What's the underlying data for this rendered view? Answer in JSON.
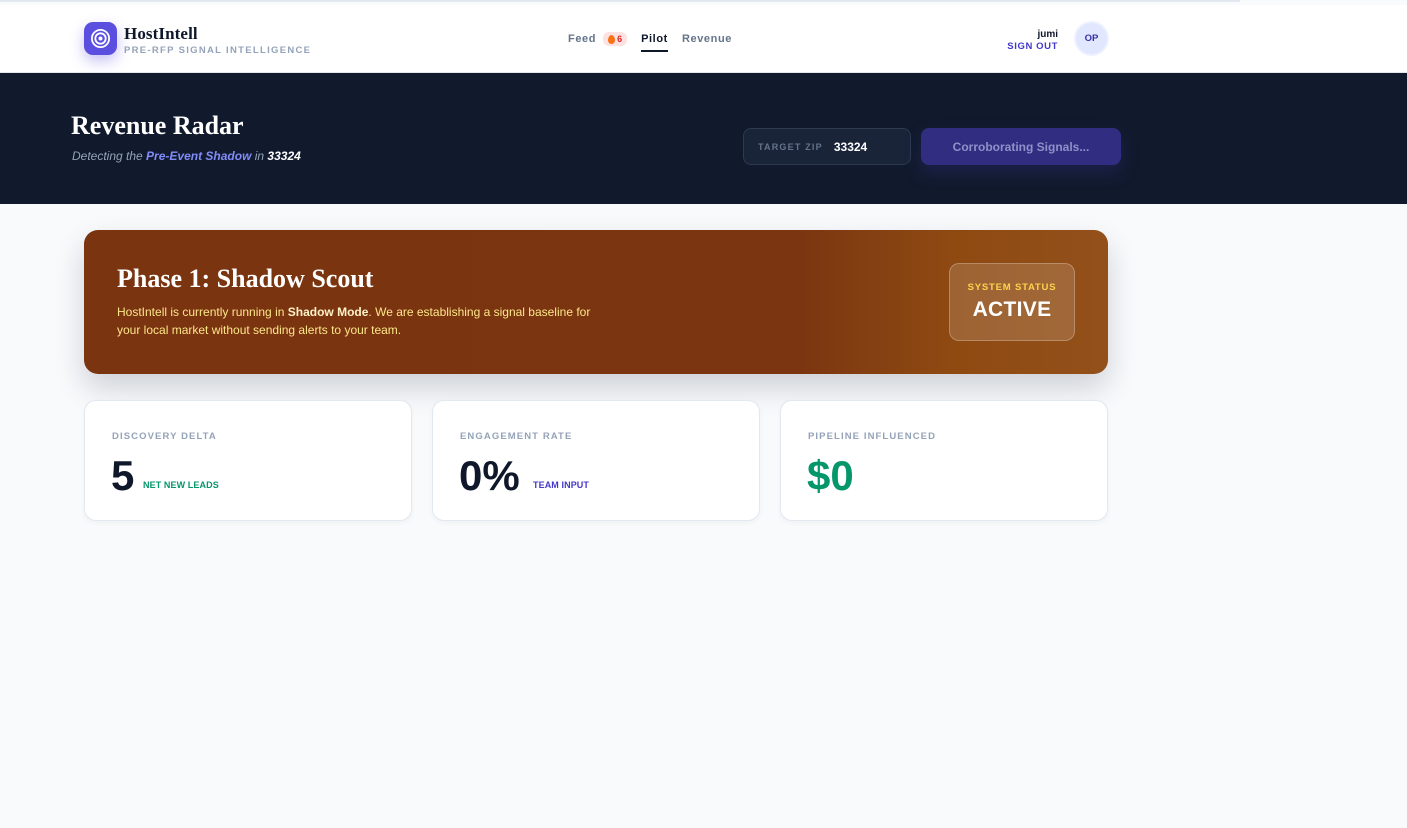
{
  "header": {
    "brand_name": "HostIntell",
    "brand_tagline": "PRE-RFP SIGNAL INTELLIGENCE",
    "nav": [
      {
        "label": "Feed",
        "badge": "6",
        "active": false
      },
      {
        "label": "Pilot",
        "active": true
      },
      {
        "label": "Revenue",
        "active": false
      }
    ],
    "user_name": "jumi",
    "sign_out_label": "SIGN OUT",
    "avatar_initials": "OP"
  },
  "hero": {
    "title": "Revenue Radar",
    "subtitle_prefix": "Detecting the ",
    "subtitle_highlight": "Pre-Event Shadow",
    "subtitle_mid": " in ",
    "subtitle_zip": "33324",
    "zip_label": "TARGET ZIP",
    "zip_value": "33324",
    "action_label": "Corroborating Signals..."
  },
  "phase": {
    "title": "Phase 1: Shadow Scout",
    "text_prefix": "HostIntell is currently running in ",
    "text_bold": "Shadow Mode",
    "text_suffix": ". We are establishing a signal baseline for your local market without sending alerts to your team.",
    "status_label": "SYSTEM STATUS",
    "status_value": "ACTIVE"
  },
  "metrics": [
    {
      "label": "DISCOVERY DELTA",
      "value": "5",
      "unit": "NET NEW LEADS",
      "value_color": "#0f172a",
      "unit_color": "#059669"
    },
    {
      "label": "ENGAGEMENT RATE",
      "value": "0%",
      "unit": "TEAM INPUT",
      "value_color": "#0f172a",
      "unit_color": "#4338ca"
    },
    {
      "label": "PIPELINE INFLUENCED",
      "value": "$0",
      "unit": "",
      "value_color": "#059669",
      "unit_color": "#059669"
    }
  ],
  "icons": {
    "logo": "target-icon",
    "feed_badge": "flame-icon"
  }
}
